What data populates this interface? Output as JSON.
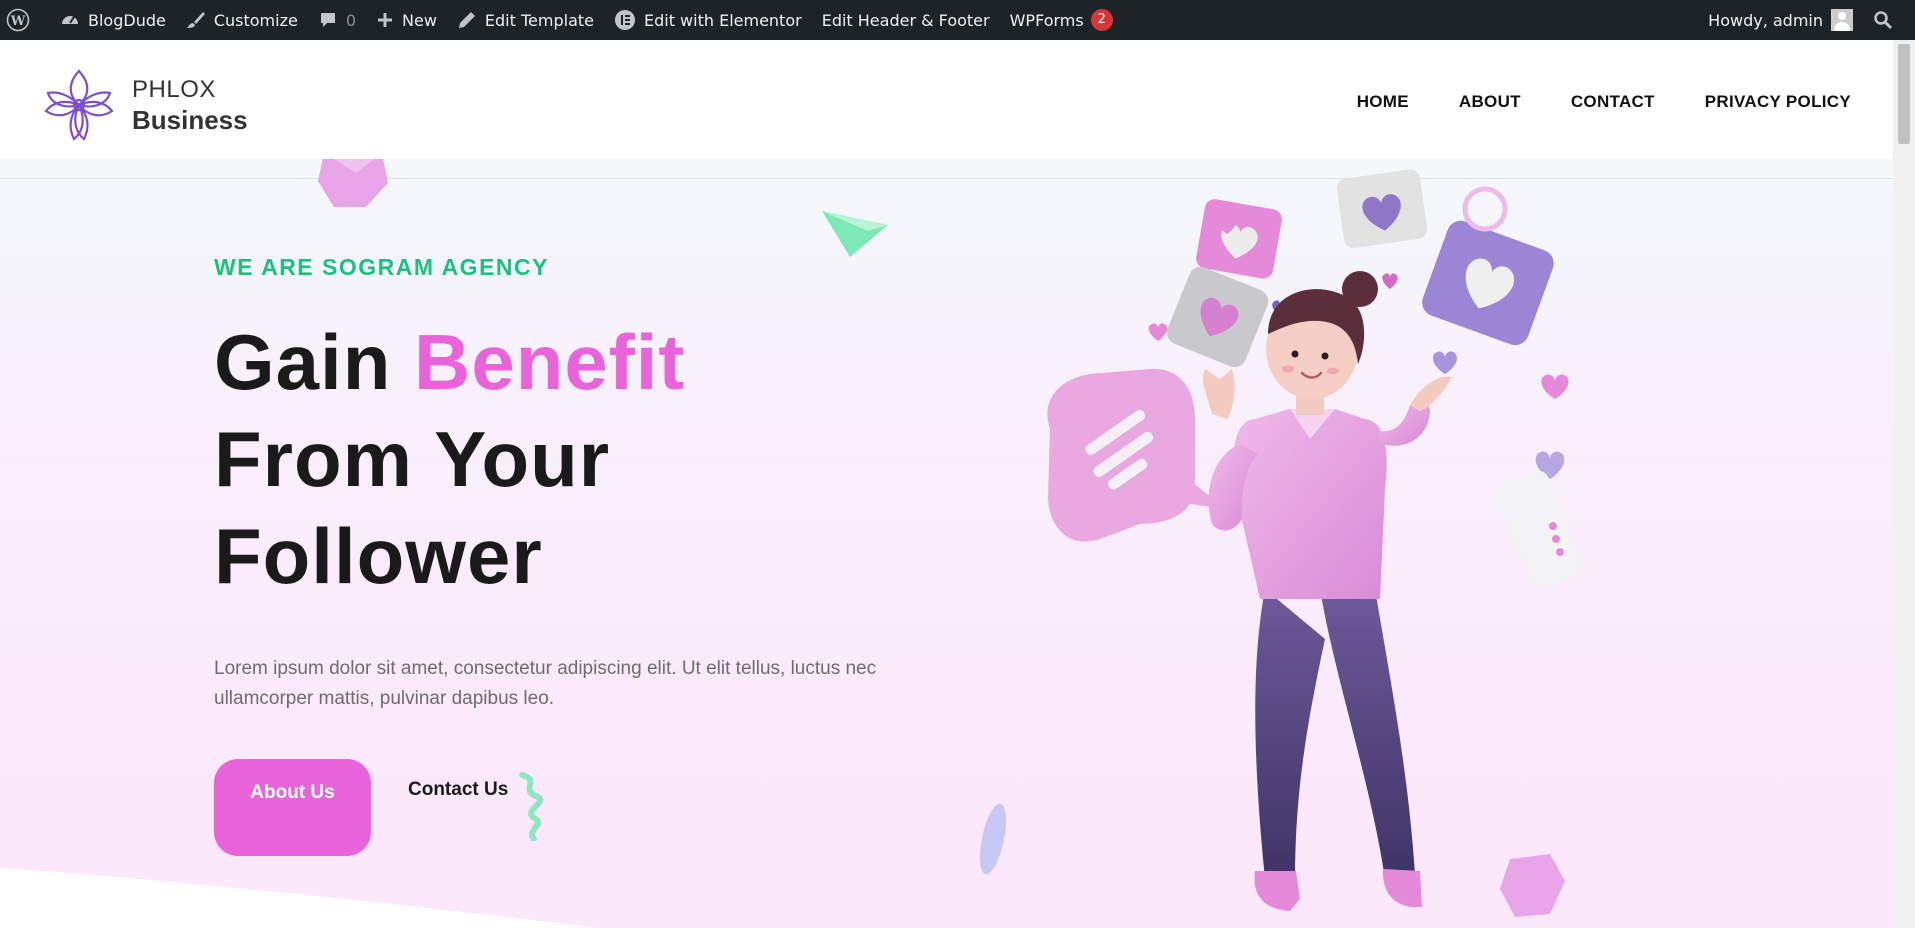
{
  "adminbar": {
    "wp_icon": "wordpress-icon",
    "items": [
      {
        "icon": "dashboard-icon",
        "label": "BlogDude"
      },
      {
        "icon": "brush-icon",
        "label": "Customize"
      },
      {
        "icon": "comment-icon",
        "label": "0"
      },
      {
        "icon": "plus-icon",
        "label": "New"
      },
      {
        "icon": "pencil-icon",
        "label": "Edit Template"
      },
      {
        "icon": "elementor-icon",
        "label": "Edit with Elementor"
      },
      {
        "label": "Edit Header & Footer"
      },
      {
        "label": "WPForms",
        "badge": "2"
      }
    ],
    "greeting": "Howdy, admin",
    "search_icon": "search-icon"
  },
  "header": {
    "logo_line1": "PHLOX",
    "logo_line2": "Business",
    "nav": [
      "HOME",
      "ABOUT",
      "CONTACT",
      "PRIVACY POLICY"
    ]
  },
  "hero": {
    "tagline": "WE ARE SOGRAM AGENCY",
    "headline_part1": "Gain ",
    "headline_accent": "Benefit",
    "headline_line2": "From Your",
    "headline_line3": "Follower",
    "description": "Lorem ipsum dolor sit amet, consectetur adipiscing elit. Ut elit tellus, luctus nec ullamcorper mattis, pulvinar dapibus leo.",
    "about_button": "About Us",
    "contact_button": "Contact Us"
  },
  "colors": {
    "accent": "#e963da",
    "tagline_green": "#1bc27e",
    "adminbar_bg": "#1d2327",
    "badge_red": "#d63638"
  }
}
